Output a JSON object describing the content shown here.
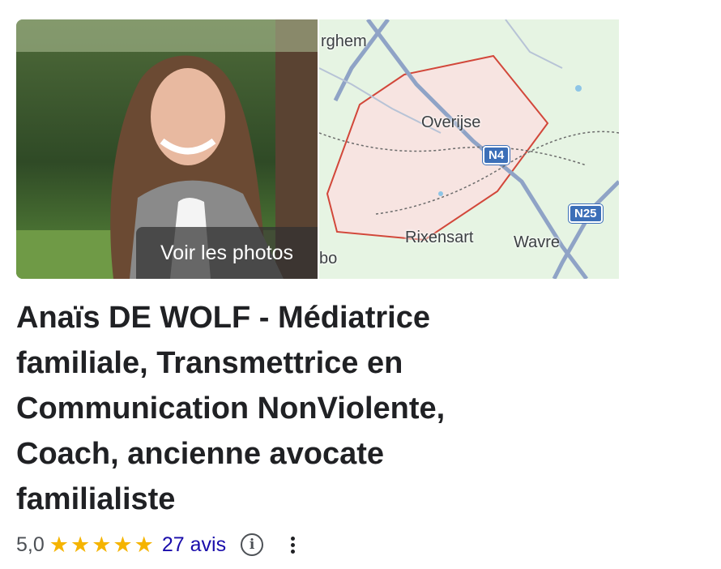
{
  "photo": {
    "overlay_label": "Voir les photos"
  },
  "map": {
    "labels": {
      "top_partial": "rghem",
      "overijse": "Overijse",
      "rixensart": "Rixensart",
      "wavre": "Wavre",
      "bottom_partial": "bo"
    },
    "road_shields": [
      "N4",
      "N25"
    ],
    "colors": {
      "land": "#e6f4e3",
      "area": "#f7e4e1",
      "border": "#d2473a",
      "road": "#8fa3c6"
    }
  },
  "business": {
    "title": "Anaïs DE WOLF - Médiatrice familiale, Transmettrice en Communication NonViolente, Coach, ancienne avocate familialiste"
  },
  "rating": {
    "score": "5,0",
    "stars_filled": 5,
    "stars_total": 5,
    "reviews_label": "27 avis",
    "star_color": "#f5b400",
    "link_color": "#1a0dab"
  },
  "icons": {
    "star": "★",
    "info": "i"
  }
}
